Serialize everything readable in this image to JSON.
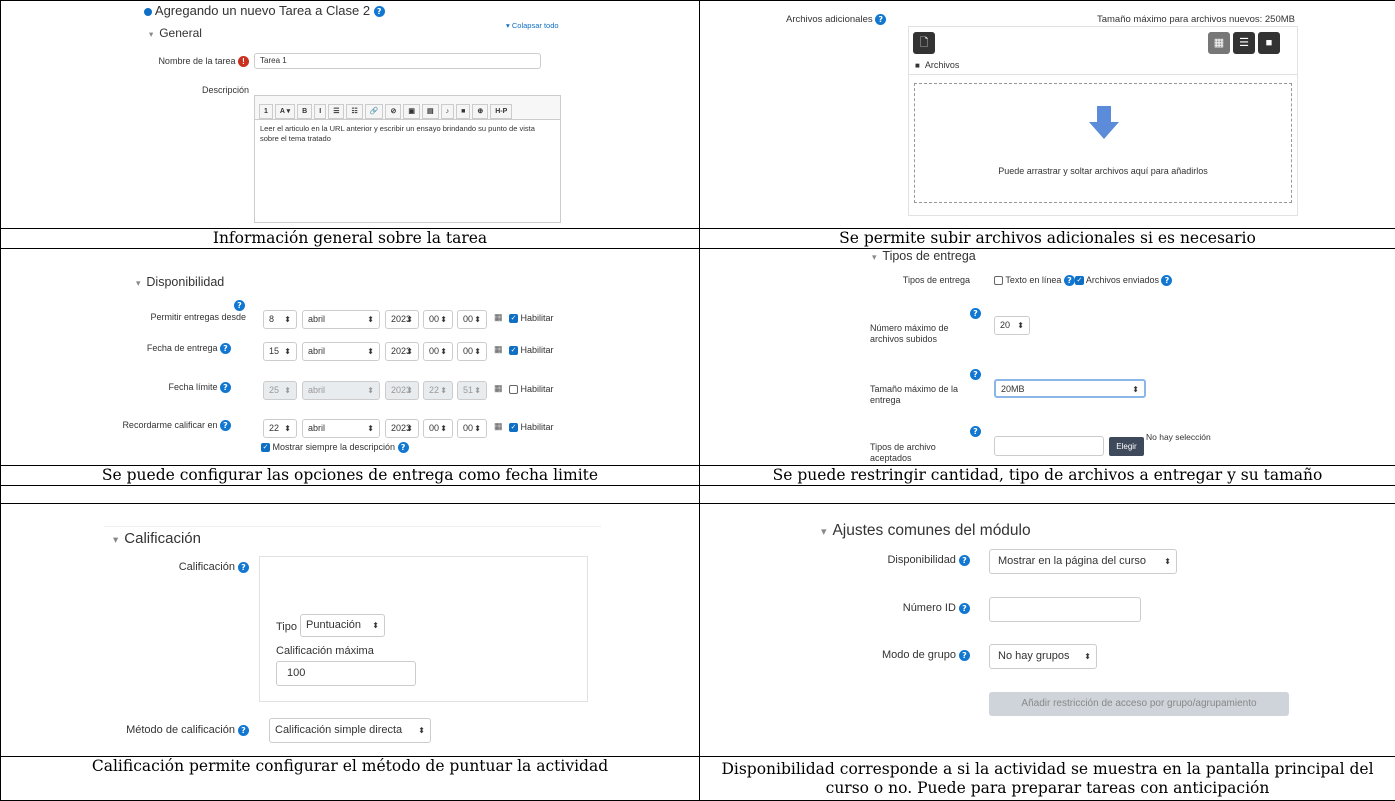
{
  "captions": {
    "general": "Información general sobre la tarea",
    "archivos": "Se permite subir archivos adicionales si es necesario",
    "disponibilidad": "Se puede configurar las opciones de entrega como fecha limite",
    "entrega": "Se puede restringir cantidad, tipo de archivos a entregar y su tamaño",
    "calificacion": "Calificación permite configurar el método de puntuar la actividad",
    "modulo": "Disponibilidad corresponde a si la actividad se muestra en la pantalla principal del curso o no. Puede para preparar tareas con anticipación"
  },
  "general": {
    "heading": "Agregando un nuevo Tarea a Clase 2",
    "collapse_all": "Colapsar todo",
    "section": "General",
    "name_label": "Nombre de la tarea",
    "name_value": "Tarea 1",
    "desc_label": "Descripción",
    "desc_value": "Leer el articulo en la URL anterior y escribir un ensayo brindando su punto de vista sobre el tema tratado",
    "toolbar": [
      "1",
      "A ▾",
      "B",
      "I",
      "☰",
      "☷",
      "🔗",
      "⊘",
      "▣",
      "▤",
      "♪",
      "■",
      "⊕",
      "H-P"
    ]
  },
  "archivos": {
    "label": "Archivos adicionales",
    "max_size": "Tamaño máximo para archivos nuevos: 250MB",
    "folder": "Archivos",
    "drop_text": "Puede arrastrar y soltar archivos aquí para añadirlos"
  },
  "disponibilidad": {
    "section": "Disponibilidad",
    "enable": "Habilitar",
    "rows": [
      {
        "label": "Permitir entregas desde",
        "day": "8",
        "month": "abril",
        "year": "2023",
        "hour": "00",
        "min": "00",
        "enabled": true
      },
      {
        "label": "Fecha de entrega",
        "day": "15",
        "month": "abril",
        "year": "2023",
        "hour": "00",
        "min": "00",
        "enabled": true
      },
      {
        "label": "Fecha límite",
        "day": "25",
        "month": "abril",
        "year": "2023",
        "hour": "22",
        "min": "51",
        "enabled": false
      },
      {
        "label": "Recordarme calificar en",
        "day": "22",
        "month": "abril",
        "year": "2023",
        "hour": "00",
        "min": "00",
        "enabled": true
      }
    ],
    "always_show": "Mostrar siempre la descripción"
  },
  "entrega": {
    "section": "Tipos de entrega",
    "types_label": "Tipos de entrega",
    "online_text": "Texto en línea",
    "files_sent": "Archivos enviados",
    "max_files_label": "Número máximo de archivos subidos",
    "max_files_value": "20",
    "max_size_label": "Tamaño máximo de la entrega",
    "max_size_value": "20MB",
    "accepted_label": "Tipos de archivo aceptados",
    "choose_button": "Elegir",
    "no_selection": "No hay selección"
  },
  "calificacion": {
    "section": "Calificación",
    "grade_label": "Calificación",
    "type_label": "Tipo",
    "type_value": "Puntuación",
    "max_label": "Calificación máxima",
    "max_value": "100",
    "method_label": "Método de calificación",
    "method_value": "Calificación simple directa"
  },
  "modulo": {
    "section": "Ajustes comunes del módulo",
    "avail_label": "Disponibilidad",
    "avail_value": "Mostrar en la página del curso",
    "id_label": "Número ID",
    "group_label": "Modo de grupo",
    "group_value": "No hay grupos",
    "restrict_button": "Añadir restricción de acceso por grupo/agrupamiento"
  }
}
